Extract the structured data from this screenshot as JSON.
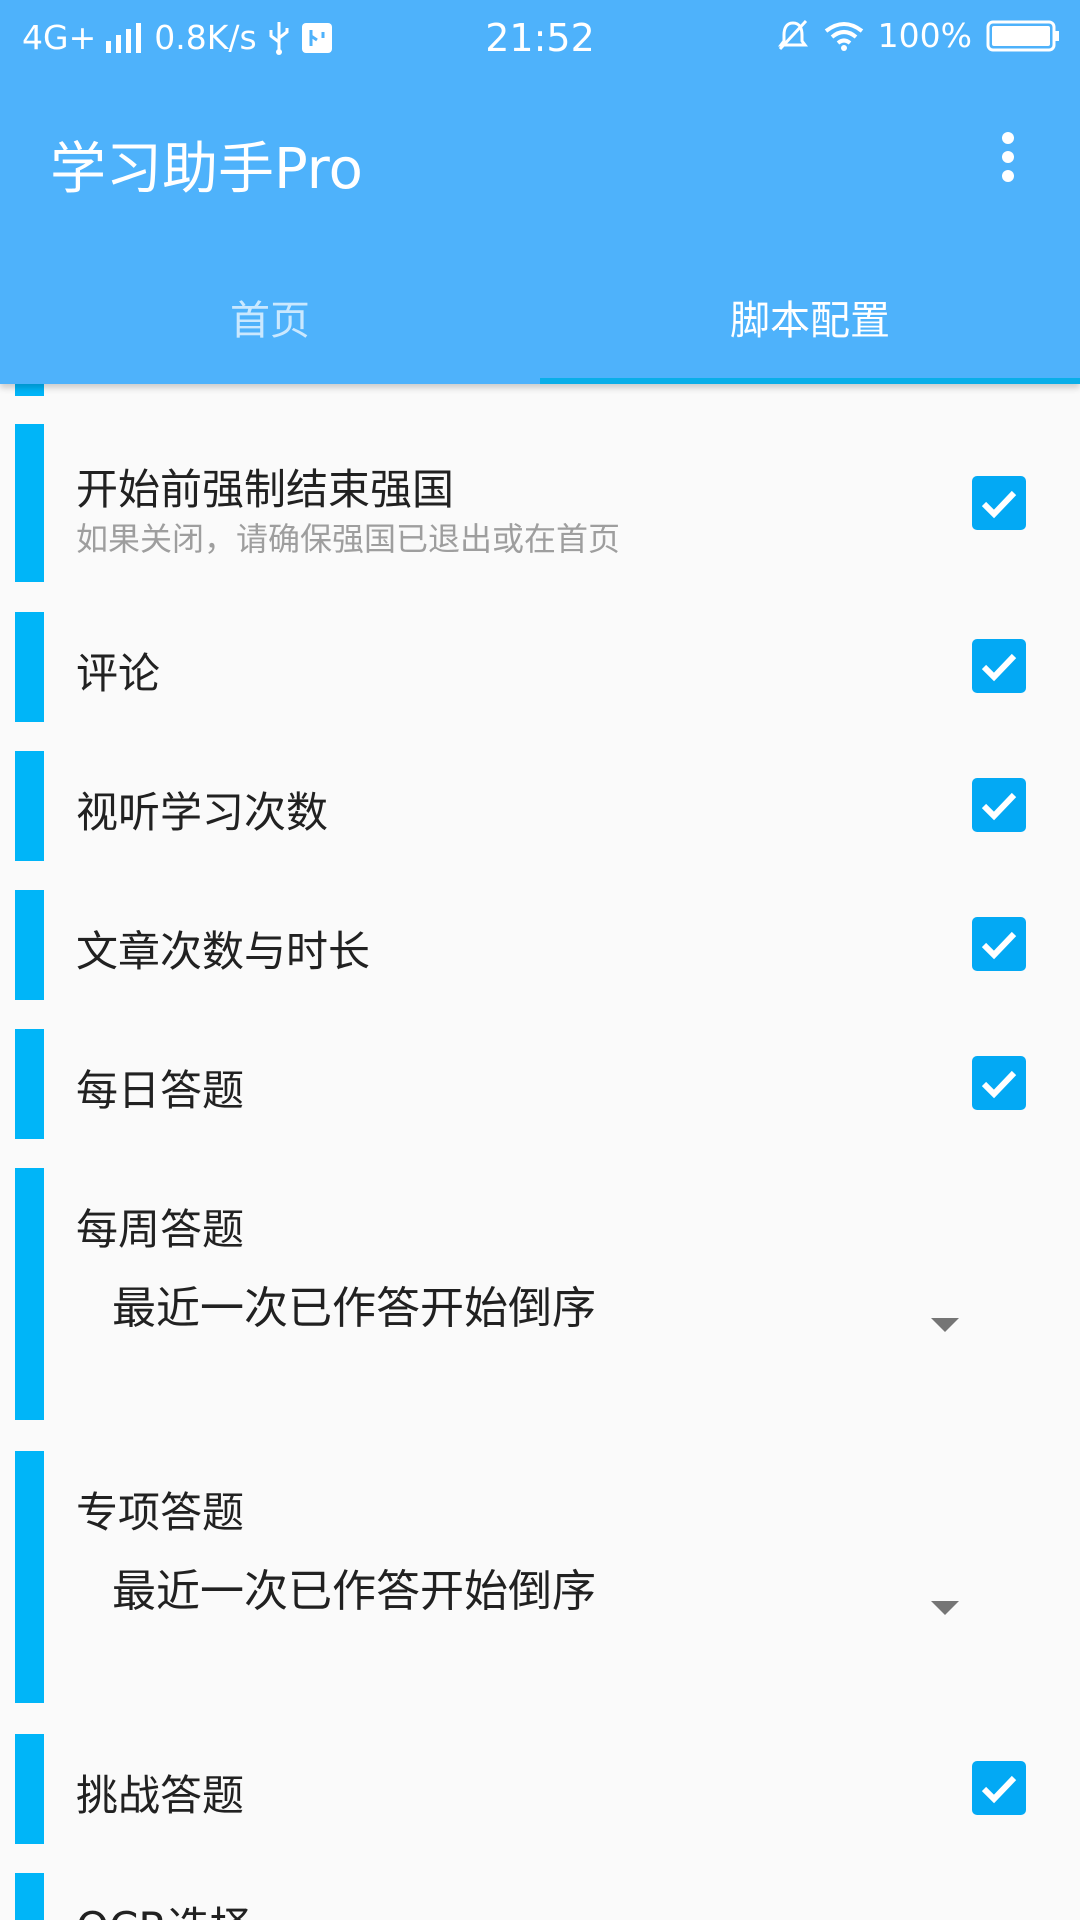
{
  "status_bar": {
    "network": "4G+",
    "speed": "0.8K/s",
    "time": "21:52",
    "battery": "100%"
  },
  "app": {
    "title": "学习助手Pro"
  },
  "tabs": [
    {
      "label": "首页"
    },
    {
      "label": "脚本配置"
    }
  ],
  "settings": {
    "force_close": {
      "label": "开始前强制结束强国",
      "desc": "如果关闭，请确保强国已退出或在首页",
      "checked": true
    },
    "comment": {
      "label": "评论",
      "checked": true
    },
    "video_count": {
      "label": "视听学习次数",
      "checked": true
    },
    "article": {
      "label": "文章次数与时长",
      "checked": true
    },
    "daily_quiz": {
      "label": "每日答题",
      "checked": true
    },
    "weekly_quiz": {
      "label": "每周答题",
      "value": "最近一次已作答开始倒序"
    },
    "special_quiz": {
      "label": "专项答题",
      "value": "最近一次已作答开始倒序"
    },
    "challenge_quiz": {
      "label": "挑战答题",
      "checked": true
    },
    "ocr": {
      "label": "OCR选择"
    }
  },
  "colors": {
    "app_bar": "#4eb2fb",
    "accent": "#00b5f8",
    "checkbox": "#03a9f4"
  }
}
